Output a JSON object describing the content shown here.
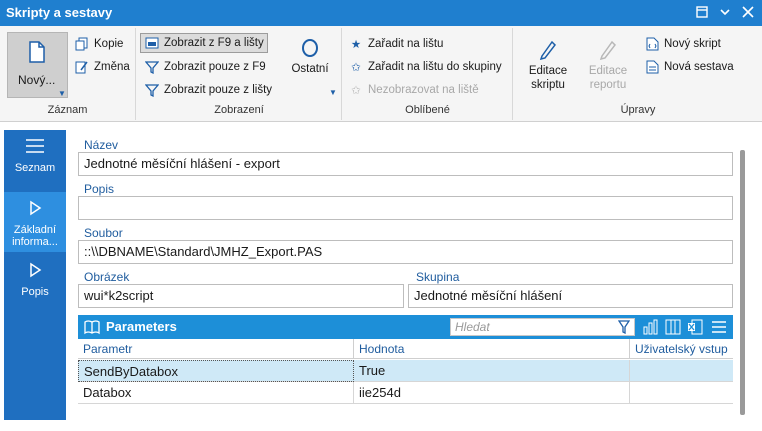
{
  "window": {
    "title": "Skripty a sestavy",
    "controls": [
      "restore-icon",
      "minimize-icon",
      "close-icon"
    ]
  },
  "ribbon": {
    "zaznam": {
      "label": "Záznam",
      "novy": "Nový...",
      "kopie": "Kopie",
      "zmena": "Změna"
    },
    "zobrazeni": {
      "label": "Zobrazení",
      "zobrazit_f9_listy": "Zobrazit z F9 a lišty",
      "zobrazit_f9": "Zobrazit pouze z F9",
      "zobrazit_listy": "Zobrazit pouze z lišty",
      "ostatni": "Ostatní"
    },
    "oblibene": {
      "label": "Oblíbené",
      "zaradit": "Zařadit na lištu",
      "zaradit_skupina": "Zařadit na lištu do skupiny",
      "nezobrazovat": "Nezobrazovat na liště"
    },
    "upravy": {
      "label": "Úpravy",
      "editace_skriptu_1": "Editace",
      "editace_skriptu_2": "skriptu",
      "editace_reportu_1": "Editace",
      "editace_reportu_2": "reportu",
      "novy_skript": "Nový skript",
      "nova_sestava": "Nová sestava"
    }
  },
  "sidebar": {
    "items": [
      {
        "label": "Seznam",
        "icon": "list-icon"
      },
      {
        "label": "Základní informa...",
        "icon": "play-icon",
        "active": true
      },
      {
        "label": "Popis",
        "icon": "play-icon"
      }
    ]
  },
  "form": {
    "nazev_label": "Název",
    "nazev_value": "Jednotné měsíční hlášení - export",
    "popis_label": "Popis",
    "popis_value": "",
    "soubor_label": "Soubor",
    "soubor_value": "::\\\\DBNAME\\Standard\\JMHZ_Export.PAS",
    "obrazek_label": "Obrázek",
    "obrazek_value": "wui*k2script",
    "skupina_label": "Skupina",
    "skupina_value": "Jednotné měsíční hlášení"
  },
  "parameters": {
    "title": "Parameters",
    "search_placeholder": "Hledat",
    "columns": [
      "Parametr",
      "Hodnota",
      "Uživatelský vstup"
    ],
    "rows": [
      [
        "SendByDatabox",
        "True",
        ""
      ],
      [
        "Databox",
        "iie254d",
        ""
      ]
    ]
  }
}
